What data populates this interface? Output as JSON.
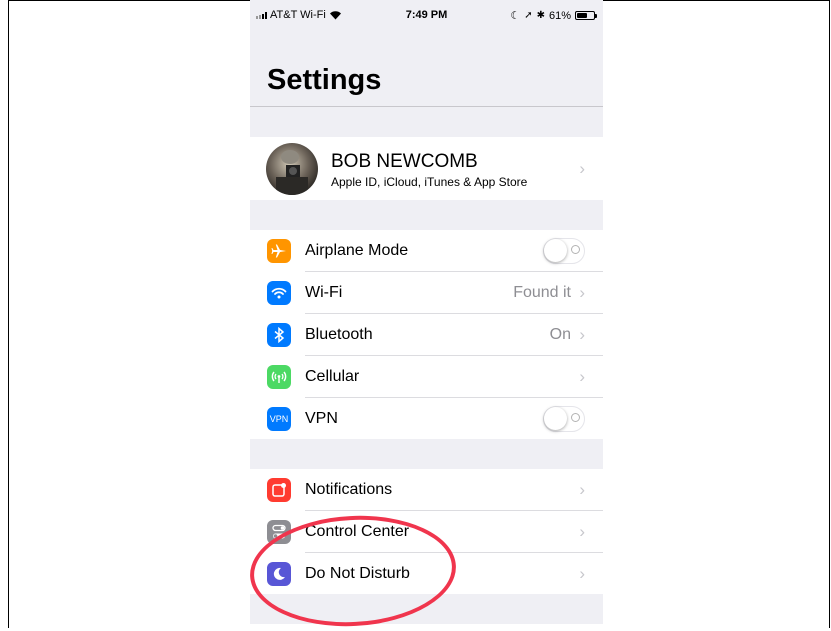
{
  "status_bar": {
    "carrier": "AT&T Wi-Fi",
    "time": "7:49 PM",
    "battery": "61%"
  },
  "page_title": "Settings",
  "profile": {
    "name": "BOB NEWCOMB",
    "subtitle": "Apple ID, iCloud, iTunes & App Store"
  },
  "group1": [
    {
      "label": "Airplane Mode",
      "icon": "airplane-icon",
      "color": "#ff9500"
    },
    {
      "label": "Wi-Fi",
      "detail": "Found it",
      "icon": "wifi-icon",
      "color": "#007aff"
    },
    {
      "label": "Bluetooth",
      "detail": "On",
      "icon": "bluetooth-icon",
      "color": "#007aff"
    },
    {
      "label": "Cellular",
      "icon": "cellular-icon",
      "color": "#4cd964"
    },
    {
      "label": "VPN",
      "icon_text": "VPN",
      "icon": "vpn-icon",
      "color": "#007aff"
    }
  ],
  "group2": [
    {
      "label": "Notifications",
      "icon": "notifications-icon",
      "color": "#ff3b30"
    },
    {
      "label": "Control Center",
      "icon": "control-center-icon",
      "color": "#8e8e93"
    },
    {
      "label": "Do Not Disturb",
      "icon": "moon-icon",
      "color": "#5856d6"
    }
  ],
  "annotation_color": "#f0354d"
}
